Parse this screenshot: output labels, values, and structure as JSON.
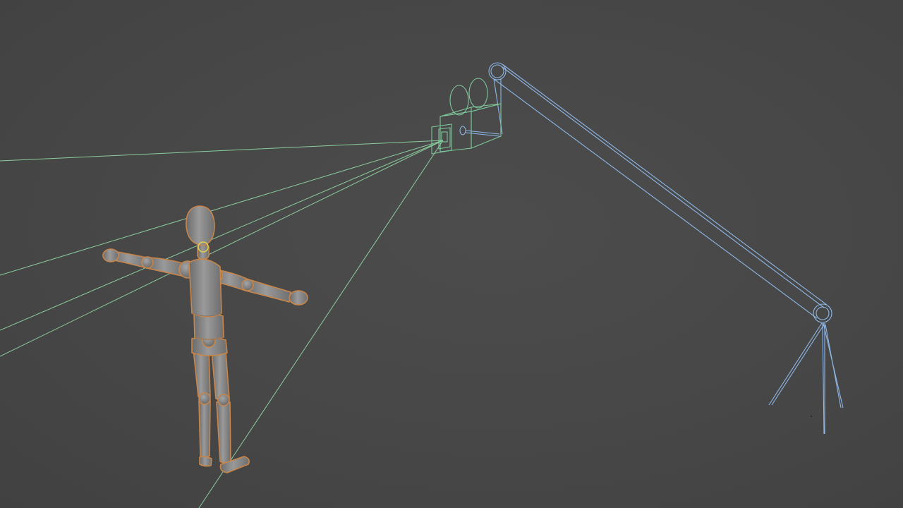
{
  "viewport": {
    "background": "#474747",
    "description_free": true
  },
  "scene": {
    "objects": [
      {
        "id": "mannequin",
        "selected": true
      },
      {
        "id": "camera"
      },
      {
        "id": "camera-crane"
      }
    ]
  },
  "colors": {
    "frustum": "#8fd3a2",
    "camera_body": "#7ec79a",
    "crane": "#8fb7e6",
    "mannequin_fill": "#8a8a8a",
    "mannequin_shade": "#6e6e6e",
    "selection_outline": "#c9864a",
    "joint_highlight": "#e0d050"
  }
}
